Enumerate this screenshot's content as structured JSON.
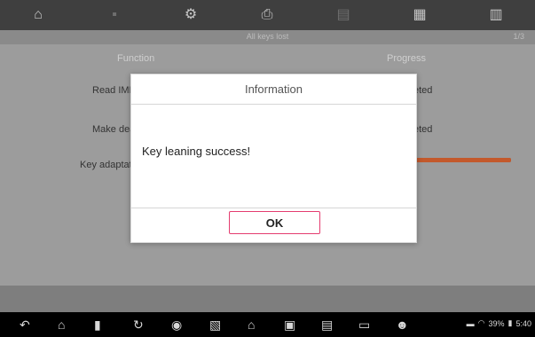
{
  "toolbar": {
    "items": [
      {
        "icon": "home-icon",
        "glyph": "⌂"
      },
      {
        "icon": "vehicle-menu-icon",
        "glyph": "▪"
      },
      {
        "icon": "settings-icon",
        "glyph": "⚙"
      },
      {
        "icon": "print-icon",
        "glyph": "⎙"
      },
      {
        "icon": "help-icon",
        "glyph": "▤"
      },
      {
        "icon": "save-icon",
        "glyph": "▦"
      },
      {
        "icon": "exit-icon",
        "glyph": "▥"
      }
    ]
  },
  "subbar": {
    "title": "All keys lost",
    "right": "1/3"
  },
  "table": {
    "columns": [
      "Function",
      "Progress"
    ],
    "rows": [
      {
        "function": "Read IMMO",
        "status": "eted"
      },
      {
        "function": "Make dealer key",
        "status": "eted"
      },
      {
        "function": "Key adaptation",
        "status": ""
      }
    ]
  },
  "dialog": {
    "title": "Information",
    "message": "Key leaning success!",
    "ok_label": "OK"
  },
  "navbar": {
    "icons": [
      "back-icon",
      "home-icon",
      "recent-apps-icon",
      "refresh-icon",
      "screenshot-icon",
      "gallery-icon",
      "app-home-icon",
      "vci-icon",
      "vehicle-connect-icon",
      "car-icon",
      "users-icon"
    ],
    "status": {
      "battery": "39%",
      "time": "5:40"
    }
  },
  "colors": {
    "accent": "#e43c6f",
    "progress": "#c3592c"
  }
}
